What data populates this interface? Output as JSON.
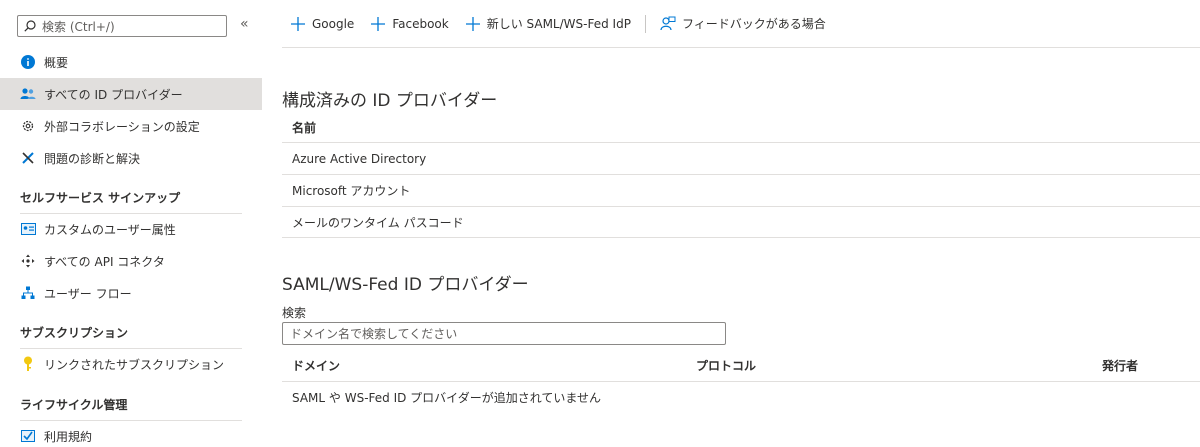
{
  "sidebar": {
    "search_placeholder": "検索 (Ctrl+/)",
    "collapse_glyph": "«",
    "items": [
      {
        "label": "概要",
        "icon": "info-icon"
      },
      {
        "label": "すべての ID プロバイダー",
        "icon": "users-icon"
      },
      {
        "label": "外部コラボレーションの設定",
        "icon": "gear-icon"
      },
      {
        "label": "問題の診断と解決",
        "icon": "wrench-icon"
      }
    ],
    "sections": [
      {
        "title": "セルフサービス サインアップ",
        "items": [
          {
            "label": "カスタムのユーザー属性",
            "icon": "user-card-icon"
          },
          {
            "label": "すべての API コネクタ",
            "icon": "connector-icon"
          },
          {
            "label": "ユーザー フロー",
            "icon": "flow-icon"
          }
        ]
      },
      {
        "title": "サブスクリプション",
        "items": [
          {
            "label": "リンクされたサブスクリプション",
            "icon": "key-icon"
          }
        ]
      },
      {
        "title": "ライフサイクル管理",
        "items": [
          {
            "label": "利用規約",
            "icon": "checklist-icon"
          }
        ]
      }
    ]
  },
  "toolbar": {
    "google": "Google",
    "facebook": "Facebook",
    "new_saml": "新しい SAML/WS-Fed IdP",
    "feedback": "フィードバックがある場合"
  },
  "configured": {
    "title": "構成済みの ID プロバイダー",
    "column": "名前",
    "rows": [
      "Azure Active Directory",
      "Microsoft アカウント",
      "メールのワンタイム パスコード"
    ]
  },
  "saml": {
    "title": "SAML/WS-Fed ID プロバイダー",
    "search_label": "検索",
    "search_placeholder": "ドメイン名で検索してください",
    "columns": [
      "ドメイン",
      "プロトコル",
      "発行者"
    ],
    "empty": "SAML や WS-Fed ID プロバイダーが追加されていません"
  },
  "colors": {
    "accent": "#0078d4",
    "selected_bg": "#e1dfdd"
  }
}
